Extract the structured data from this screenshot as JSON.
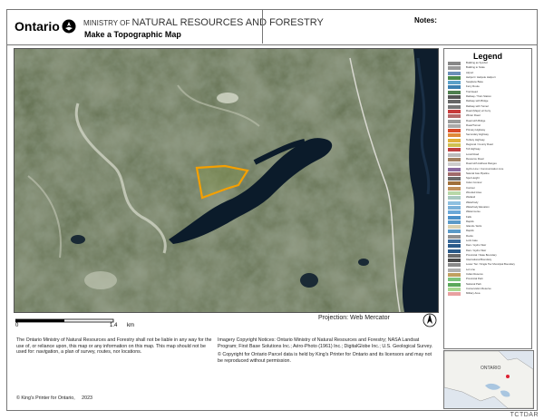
{
  "header": {
    "org": "Ontario",
    "ministry_prefix": "MINISTRY OF",
    "ministry_name": "NATURAL RESOURCES AND FORESTRY",
    "subtitle": "Make a Topographic Map",
    "notes_label": "Notes:"
  },
  "legend": {
    "title": "Legend",
    "items": [
      {
        "label": "Building as Symbol",
        "color": "#888888"
      },
      {
        "label": "Building to Scale",
        "color": "#999999"
      },
      {
        "label": "Airport",
        "color": "#6b8fb8"
      },
      {
        "label": "Heliport / Helipole Heliport",
        "color": "#4a8a4a"
      },
      {
        "label": "Seaplane Base",
        "color": "#5aa0c8"
      },
      {
        "label": "Ferry Route",
        "color": "#3b7fb0"
      },
      {
        "label": "Trail Head",
        "color": "#4f7f4f"
      },
      {
        "label": "Railway / Train Station",
        "color": "#555555"
      },
      {
        "label": "Railway with Bridge",
        "color": "#666666"
      },
      {
        "label": "Railway with Tunnel",
        "color": "#777777"
      },
      {
        "label": "Road (Major) w/ Ferry",
        "color": "#c83a3a"
      },
      {
        "label": "Winter Road",
        "color": "#b56a6a"
      },
      {
        "label": "Road with Bridge",
        "color": "#9a9a9a"
      },
      {
        "label": "Road/Tunnel",
        "color": "#aaaaaa"
      },
      {
        "label": "Primary Highway",
        "color": "#d94a2a"
      },
      {
        "label": "Secondary Highway",
        "color": "#e08a3a"
      },
      {
        "label": "Tertiary Highway",
        "color": "#e0b03a"
      },
      {
        "label": "Regional / County Road",
        "color": "#d0c050"
      },
      {
        "label": "Toll Highway",
        "color": "#c04040"
      },
      {
        "label": "Local Road",
        "color": "#bbbbbb"
      },
      {
        "label": "Resource Road",
        "color": "#a08060"
      },
      {
        "label": "Road with Address Ranges",
        "color": "#cccccc"
      },
      {
        "label": "Hydro Line / Communication Line",
        "color": "#8a6aa0"
      },
      {
        "label": "Natural Gas Pipeline",
        "color": "#a06a6a"
      },
      {
        "label": "Spot Height",
        "color": "#6a6a6a"
      },
      {
        "label": "Index Contour",
        "color": "#a0703a"
      },
      {
        "label": "Contour",
        "color": "#c0905a"
      },
      {
        "label": "Wooded Area",
        "color": "#b8d8a8"
      },
      {
        "label": "Wetland",
        "color": "#a8c8c0"
      },
      {
        "label": "Waterbody",
        "color": "#8ec0e0"
      },
      {
        "label": "Waterbody Elevation",
        "color": "#7ab0d8"
      },
      {
        "label": "Watercourse",
        "color": "#6aa8d8"
      },
      {
        "label": "Falls",
        "color": "#4a90c8"
      },
      {
        "label": "Rapids",
        "color": "#5a9ac8"
      },
      {
        "label": "Islands / Exits",
        "color": "#d8d0b0"
      },
      {
        "label": "Rapids",
        "color": "#5a9ac8"
      },
      {
        "label": "Rocks",
        "color": "#909090"
      },
      {
        "label": "Lock Gate",
        "color": "#3a6a9a"
      },
      {
        "label": "Dam / Hydro Weir",
        "color": "#2a5a8a"
      },
      {
        "label": "Dam / Hydro Weir",
        "color": "#2a5a8a"
      },
      {
        "label": "Provincial / State Boundary",
        "color": "#6a6a6a"
      },
      {
        "label": "International Boundary",
        "color": "#4a4a4a"
      },
      {
        "label": "Lower Tier / Single Tier Municipal Boundary",
        "color": "#8a8a8a"
      },
      {
        "label": "Lot Line",
        "color": "#b0b0b0"
      },
      {
        "label": "Indian Reserve",
        "color": "#c0a060"
      },
      {
        "label": "Provincial Park",
        "color": "#7cc47c"
      },
      {
        "label": "National Park",
        "color": "#5aa85a"
      },
      {
        "label": "Conservation Reserve",
        "color": "#a8d890"
      },
      {
        "label": "Military Area",
        "color": "#e8a0a0"
      }
    ]
  },
  "scale": {
    "zero": "0",
    "distance": "1.4",
    "unit": "km"
  },
  "projection": "Projection: Web Mercator",
  "disclaimer": "The Ontario Ministry of Natural Resources and Forestry shall not be liable in any way for the use of, or reliance upon, this map or any information on this map. This map should not be used for: navigation, a plan of survey, routes, nor locations.",
  "imagery_notice": "Imagery Copyright Notices: Ontario Ministry of Natural Resources and Forestry; NASA Landsat Program; First Base Solutions Inc.; Aéro-Photo (1961) Inc.; DigitalGlobe Inc.; U.S. Geological Survey.",
  "parcel_notice": "© Copyright for Ontario Parcel data is held by King's Printer for Ontario and its licensors and may not be reproduced without permission.",
  "copyright": "© King's Printer for Ontario,",
  "year": "2023",
  "inset_label": "ONTARIO",
  "watermark": "TCTDAR",
  "colors": {
    "outline": "#f5a000",
    "water": "#0b1b2a",
    "forest": "#4a5a3a"
  }
}
